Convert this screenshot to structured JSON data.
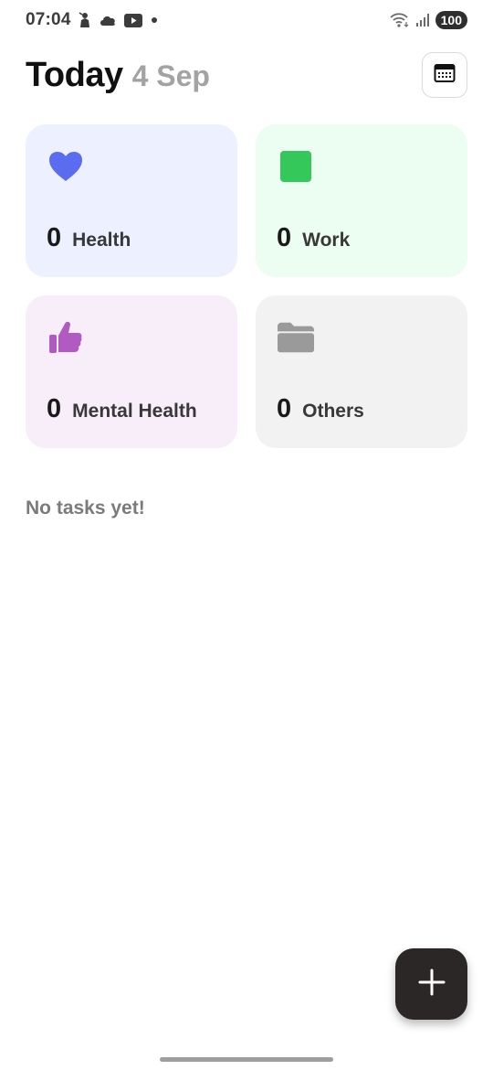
{
  "status_bar": {
    "time": "07:04",
    "battery": "100",
    "icons": [
      "person-notification-icon",
      "cloud-icon",
      "youtube-icon",
      "dot-icon",
      "wifi-icon",
      "signal-icon"
    ]
  },
  "header": {
    "title": "Today",
    "date": "4 Sep",
    "calendar_icon": "calendar-icon"
  },
  "categories": [
    {
      "count": "0",
      "label": "Health",
      "icon": "heart-icon",
      "bg": "#edf1ff",
      "icon_color": "#5b6cf0"
    },
    {
      "count": "0",
      "label": "Work",
      "icon": "square-icon",
      "bg": "#ecfdf1",
      "icon_color": "#34c759"
    },
    {
      "count": "0",
      "label": "Mental Health",
      "icon": "thumbs-up-icon",
      "bg": "#f7eef9",
      "icon_color": "#b05ac2"
    },
    {
      "count": "0",
      "label": "Others",
      "icon": "folder-icon",
      "bg": "#f2f2f2",
      "icon_color": "#9a9a9a"
    }
  ],
  "tasks": {
    "empty_text": "No tasks yet!"
  },
  "fab": {
    "icon": "plus-icon"
  }
}
